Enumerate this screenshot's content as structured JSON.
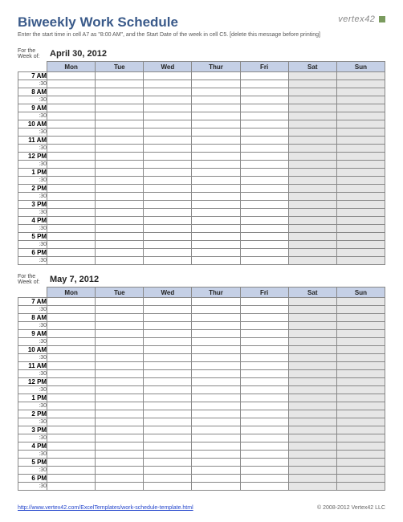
{
  "title": "Biweekly Work Schedule",
  "subtitle": "Enter the start time in cell A7 as \"8:00 AM\", and the Start Date of the week in cell C5. [delete this message before printing]",
  "logo": "vertex",
  "logo_suffix": "42",
  "week_label_line1": "For the",
  "week_label_line2": "Week of:",
  "days": [
    "Mon",
    "Tue",
    "Wed",
    "Thur",
    "Fri",
    "Sat",
    "Sun"
  ],
  "hours": [
    "7 AM",
    "8 AM",
    "9 AM",
    "10 AM",
    "11 AM",
    "12 PM",
    "1 PM",
    "2 PM",
    "3 PM",
    "4 PM",
    "5 PM",
    "6 PM"
  ],
  "half_label": ":30",
  "weeks": [
    {
      "date": "April 30, 2012"
    },
    {
      "date": "May 7, 2012"
    }
  ],
  "footer_link": "http://www.vertex42.com/ExcelTemplates/work-schedule-template.html",
  "copyright": "© 2008-2012 Vertex42 LLC"
}
